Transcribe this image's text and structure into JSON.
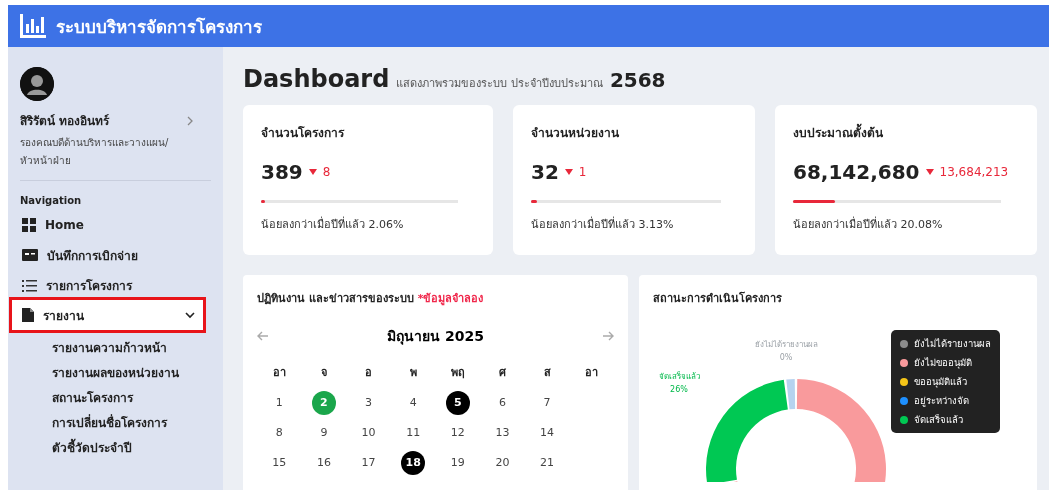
{
  "header": {
    "title": "ระบบบริหารจัดการโครงการ"
  },
  "sidebar": {
    "user": {
      "name": "สิริรัตน์ ทองอินทร์",
      "role": "รองคณบดีด้านบริหารและวางแผน/หัวหน้าฝ่าย"
    },
    "section_title": "Navigation",
    "items": [
      {
        "label": "Home",
        "selected": false,
        "highlighted": false
      },
      {
        "label": "บันทึกการเบิกจ่าย",
        "selected": false,
        "highlighted": false
      },
      {
        "label": "รายการโครงการ",
        "selected": false,
        "highlighted": false
      },
      {
        "label": "รายงาน",
        "selected": true,
        "highlighted": true,
        "expanded": true,
        "children": [
          {
            "label": "รายงานความก้าวหน้า"
          },
          {
            "label": "รายงานผลของหน่วยงาน"
          },
          {
            "label": "สถานะโครงการ"
          },
          {
            "label": "การเปลี่ยนชื่อโครงการ"
          },
          {
            "label": "ตัวชี้วัดประจำปี"
          }
        ]
      }
    ]
  },
  "page": {
    "title": "Dashboard",
    "subtitle": "แสดงภาพรวมของระบบ ประจำปีงบประมาณ",
    "year": "2568"
  },
  "stats": [
    {
      "label": "จำนวนโครงการ",
      "value": "389",
      "decreased": true,
      "delta": "8",
      "level": 0.02,
      "note": "น้อยลงกว่าเมื่อปีที่แล้ว 2.06%"
    },
    {
      "label": "จำนวนหน่วยงาน",
      "value": "32",
      "decreased": true,
      "delta": "1",
      "level": 0.03,
      "note": "น้อยลงกว่าเมื่อปีที่แล้ว 3.13%"
    },
    {
      "label": "งบประมาณตั้งต้น",
      "value": "68,142,680",
      "decreased": true,
      "delta": "13,684,213",
      "level": 0.2,
      "note": "น้อยลงกว่าเมื่อปีที่แล้ว 20.08%"
    }
  ],
  "calendar": {
    "title": "ปฏิทินงาน และข่าวสารของระบบ",
    "tag": "*ข้อมูลจำลอง",
    "month": "มิถุนายน 2025",
    "weekdays": [
      "อา",
      "จ",
      "อ",
      "พ",
      "พฤ",
      "ศ",
      "ส",
      "อา"
    ],
    "weeks": [
      [
        {
          "day": "1"
        },
        {
          "day": "2",
          "color": "#1aa64b"
        },
        {
          "day": "3"
        },
        {
          "day": "4"
        },
        {
          "day": "5",
          "color": "#000000"
        },
        {
          "day": "6"
        },
        {
          "day": "7"
        }
      ],
      [
        {
          "day": "8"
        },
        {
          "day": "9"
        },
        {
          "day": "10"
        },
        {
          "day": "11"
        },
        {
          "day": "12"
        },
        {
          "day": "13"
        },
        {
          "day": "14"
        }
      ],
      [
        {
          "day": "15"
        },
        {
          "day": "16"
        },
        {
          "day": "17"
        },
        {
          "day": "18",
          "color": "#000000"
        },
        {
          "day": "19"
        },
        {
          "day": "20"
        },
        {
          "day": "21"
        }
      ]
    ]
  },
  "status": {
    "title": "สถานะการดำเนินโครงการ",
    "labels": [
      {
        "text": "ยังไม่ได้รายงานผล",
        "value": "0%"
      },
      {
        "text": "จัดเสร็จแล้ว",
        "value": "26%"
      }
    ],
    "legend": [
      {
        "label": "ยังไม่ได้รายงานผล",
        "color": "#8c8c8c"
      },
      {
        "label": "ยังไม่ขออนุมัติ",
        "color": "#f99a9c"
      },
      {
        "label": "ขออนุมัติแล้ว",
        "color": "#f5c518"
      },
      {
        "label": "อยู่ระหว่างจัด",
        "color": "#1e90ff"
      },
      {
        "label": "จัดเสร็จแล้ว",
        "color": "#00c853"
      }
    ]
  }
}
